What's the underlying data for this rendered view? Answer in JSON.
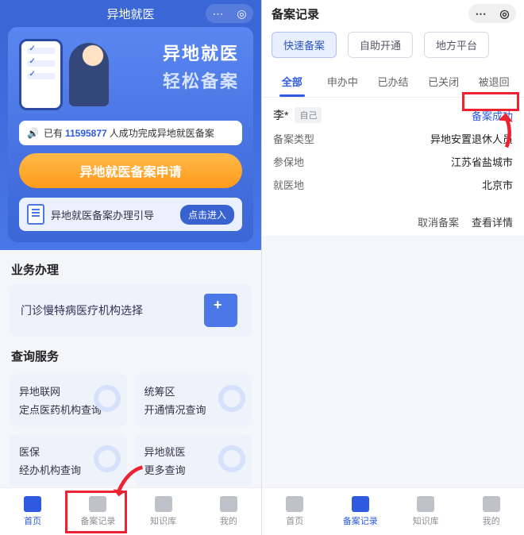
{
  "left": {
    "header": {
      "title": "异地就医"
    },
    "hero": {
      "line1": "异地就医",
      "line2": "轻松备案",
      "stat_prefix": "已有",
      "stat_number": "11595877",
      "stat_suffix": "人成功完成异地就医备案",
      "apply_button": "异地就医备案申请",
      "guide_text": "异地就医备案办理引导",
      "guide_enter": "点击进入"
    },
    "biz": {
      "title": "业务办理",
      "card1": "门诊慢特病医疗机构选择"
    },
    "query": {
      "title": "查询服务",
      "cards": [
        {
          "t1": "异地联网",
          "t2": "定点医药机构查询"
        },
        {
          "t1": "统筹区",
          "t2": "开通情况查询"
        },
        {
          "t1": "医保",
          "t2": "经办机构查询"
        },
        {
          "t1": "异地就医",
          "t2": "更多查询"
        }
      ]
    },
    "tabs": [
      "首页",
      "备案记录",
      "知识库",
      "我的"
    ]
  },
  "right": {
    "header": {
      "title": "备案记录"
    },
    "pills": [
      "快速备案",
      "自助开通",
      "地方平台"
    ],
    "segs": [
      "全部",
      "申办中",
      "已办结",
      "已关闭",
      "被退回"
    ],
    "record": {
      "name": "李*",
      "tag": "自己",
      "status": "备案成功",
      "rows": [
        {
          "k": "备案类型",
          "v": "异地安置退休人员"
        },
        {
          "k": "参保地",
          "v": "江苏省盐城市"
        },
        {
          "k": "就医地",
          "v": "北京市"
        }
      ],
      "act_cancel": "取消备案",
      "act_detail": "查看详情"
    },
    "tabs": [
      "首页",
      "备案记录",
      "知识库",
      "我的"
    ]
  }
}
